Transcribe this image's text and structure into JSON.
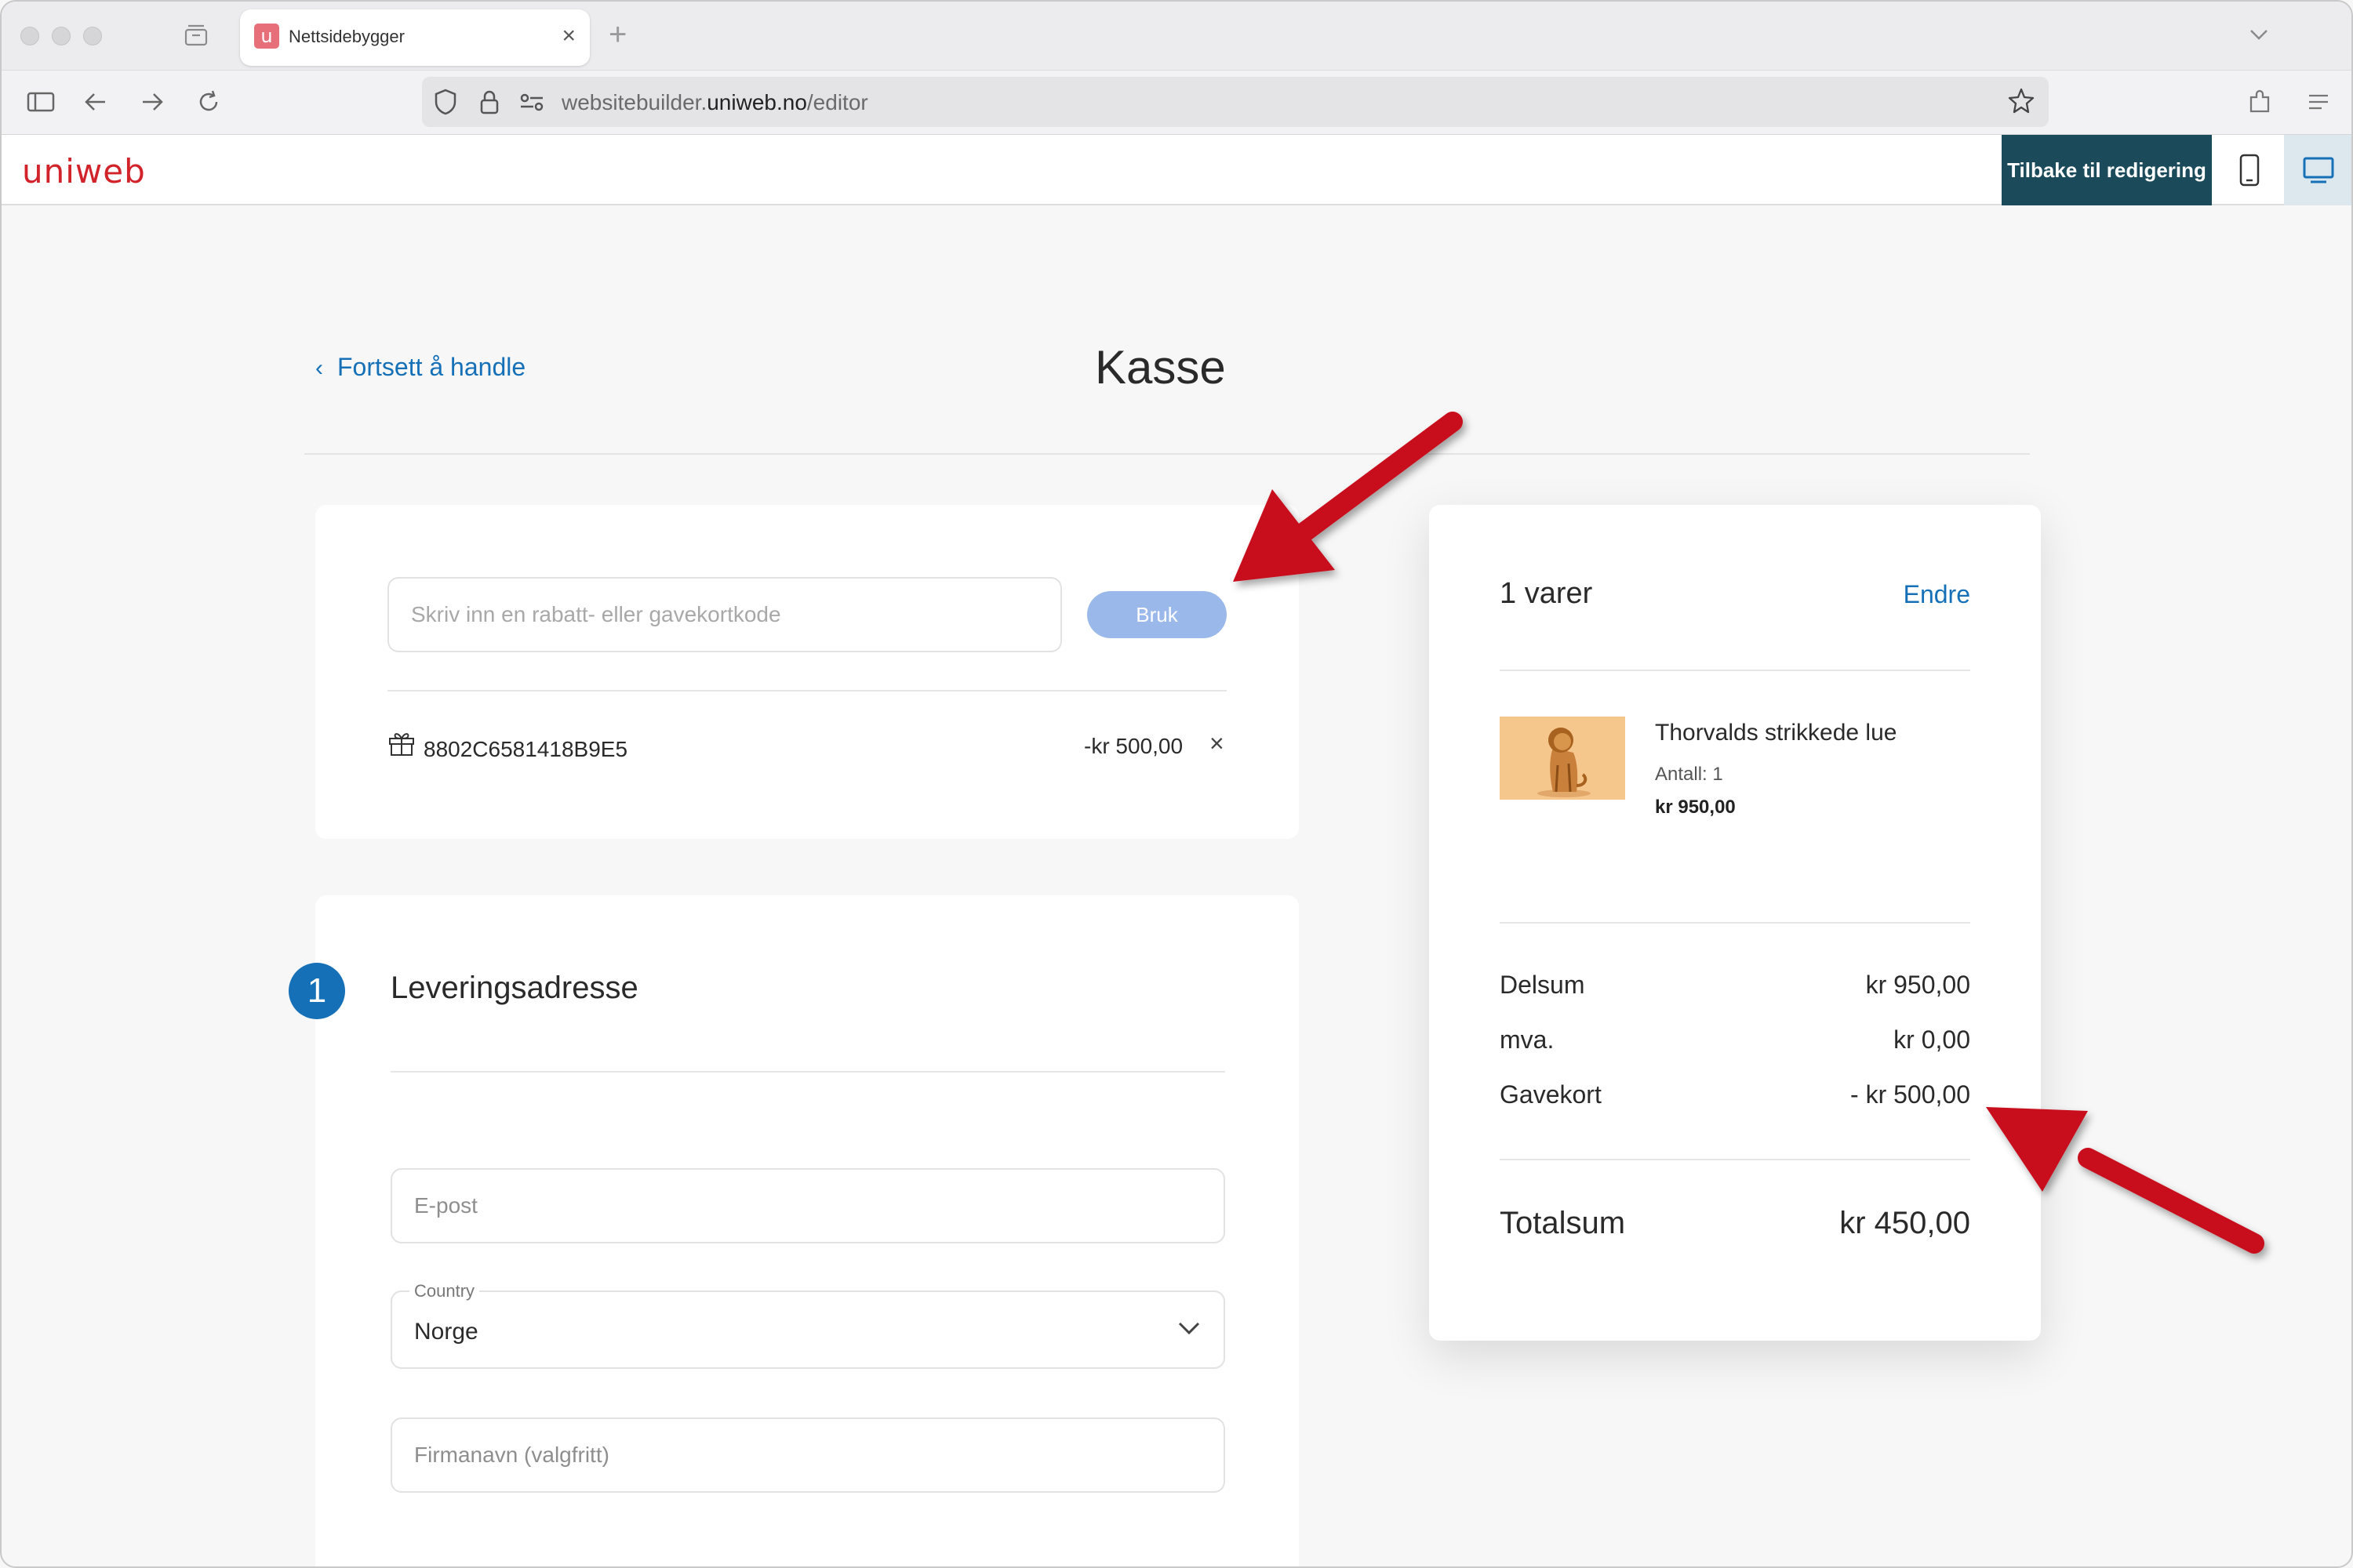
{
  "browser": {
    "tab_title": "Nettsidebygger",
    "url_prefix": "websitebuilder.",
    "url_domain": "uniweb.no",
    "url_path": "/editor"
  },
  "app": {
    "logo": "uniweb",
    "back_to_edit": "Tilbake til redigering"
  },
  "page": {
    "back_link": "Fortsett å handle",
    "title": "Kasse"
  },
  "coupon": {
    "placeholder": "Skriv inn en rabatt- eller gavekortkode",
    "apply_label": "Bruk",
    "applied_code": "8802C6581418B9E5",
    "applied_amount": "-kr 500,00"
  },
  "delivery": {
    "step_number": "1",
    "title": "Leveringsadresse",
    "email_placeholder": "E-post",
    "country_label": "Country",
    "country_value": "Norge",
    "company_placeholder": "Firmanavn (valgfritt)"
  },
  "summary": {
    "item_count": "1 varer",
    "edit_label": "Endre",
    "product": {
      "name": "Thorvalds strikkede lue",
      "quantity": "Antall: 1",
      "price": "kr 950,00"
    },
    "rows": [
      {
        "label": "Delsum",
        "value": "kr 950,00"
      },
      {
        "label": "mva.",
        "value": "kr 0,00"
      },
      {
        "label": "Gavekort",
        "value": "- kr 500,00"
      }
    ],
    "total_label": "Totalsum",
    "total_value": "kr 450,00"
  },
  "colors": {
    "brand_red": "#d2232a",
    "link_blue": "#1570b8",
    "header_button": "#1b4b5a",
    "apply_button": "#9bb8ea",
    "annotation_arrow": "#c8101e"
  }
}
